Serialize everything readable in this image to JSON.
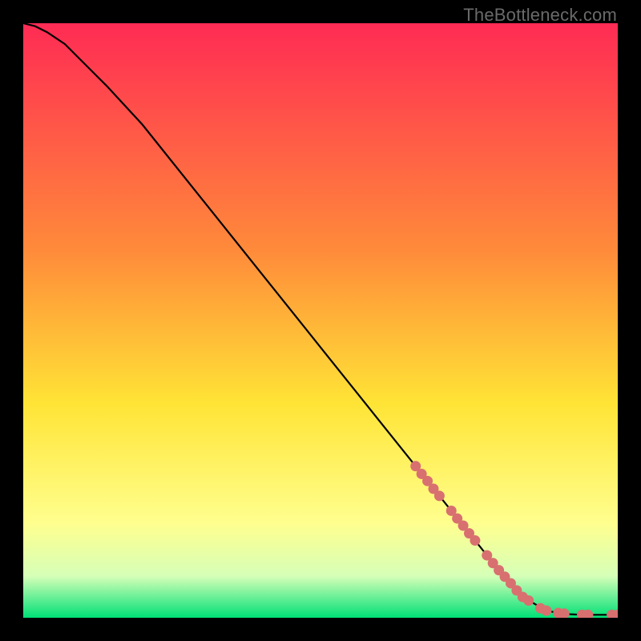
{
  "watermark": "TheBottleneck.com",
  "colors": {
    "background": "#000000",
    "gradient_top": "#ff2b54",
    "gradient_mid1": "#ff8a3a",
    "gradient_mid2": "#ffe436",
    "gradient_mid3": "#ffff8e",
    "gradient_mid4": "#d6ffb8",
    "gradient_bottom": "#00e076",
    "curve": "#000000",
    "dot": "#d87070"
  },
  "chart_data": {
    "type": "line",
    "title": "",
    "xlabel": "",
    "ylabel": "",
    "xlim": [
      0,
      100
    ],
    "ylim": [
      0,
      100
    ],
    "curve": {
      "x": [
        0,
        2,
        4,
        7,
        10,
        14,
        20,
        30,
        40,
        50,
        60,
        70,
        80,
        84,
        88,
        90,
        92,
        94,
        96,
        98,
        100
      ],
      "y": [
        100,
        99.5,
        98.5,
        96.5,
        93.5,
        89.5,
        83,
        70.5,
        58,
        45.5,
        33,
        20.5,
        8,
        3.5,
        1.2,
        0.8,
        0.6,
        0.5,
        0.5,
        0.5,
        0.5
      ]
    },
    "highlight_dots": {
      "x": [
        66,
        67,
        68,
        69,
        70,
        72,
        73,
        74,
        75,
        76,
        78,
        79,
        80,
        81,
        82,
        83,
        84,
        85,
        87,
        88,
        90,
        91,
        94,
        95,
        99,
        100
      ],
      "y": [
        25.5,
        24.2,
        23.0,
        21.7,
        20.5,
        18.0,
        16.7,
        15.5,
        14.2,
        13.0,
        10.5,
        9.2,
        8.0,
        6.9,
        5.8,
        4.6,
        3.5,
        2.9,
        1.6,
        1.2,
        0.8,
        0.7,
        0.5,
        0.5,
        0.5,
        0.5
      ]
    }
  }
}
